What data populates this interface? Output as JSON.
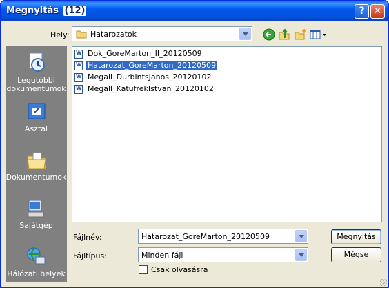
{
  "titlebar": {
    "title": "Megnyitás",
    "count": "(12)",
    "help_label": "?",
    "close_label": "✕"
  },
  "location": {
    "label": "Hely:",
    "value": "Hatarozatok"
  },
  "toolbar": {
    "icons": [
      "back-icon",
      "up-folder-icon",
      "new-folder-icon",
      "view-menu-icon"
    ]
  },
  "places": [
    {
      "label": "Legutóbbi dokumentumok",
      "icon": "recent-documents-icon"
    },
    {
      "label": "Asztal",
      "icon": "desktop-icon"
    },
    {
      "label": "Dokumentumok",
      "icon": "documents-folder-icon"
    },
    {
      "label": "Sajátgép",
      "icon": "my-computer-icon"
    },
    {
      "label": "Hálózati helyek",
      "icon": "network-places-icon"
    }
  ],
  "files": [
    {
      "name": "Dok_GoreMarton_II_20120509",
      "selected": false
    },
    {
      "name": "Hatarozat_GoreMarton_20120509",
      "selected": true
    },
    {
      "name": "Megall_DurbintsJanos_20120102",
      "selected": false
    },
    {
      "name": "Megall_KatufrekIstvan_20120102",
      "selected": false
    }
  ],
  "filename": {
    "label": "Fájlnév:",
    "value": "Hatarozat_GoreMarton_20120509"
  },
  "filetype": {
    "label": "Fájltípus:",
    "value": "Minden fájl"
  },
  "readonly": {
    "label": "Csak olvasásra",
    "checked": false
  },
  "buttons": {
    "open": "Megnyitás",
    "cancel": "Mégse"
  },
  "colors": {
    "selection": "#316ac5",
    "titlebar": "#0058ee",
    "places_bg": "#808080"
  }
}
